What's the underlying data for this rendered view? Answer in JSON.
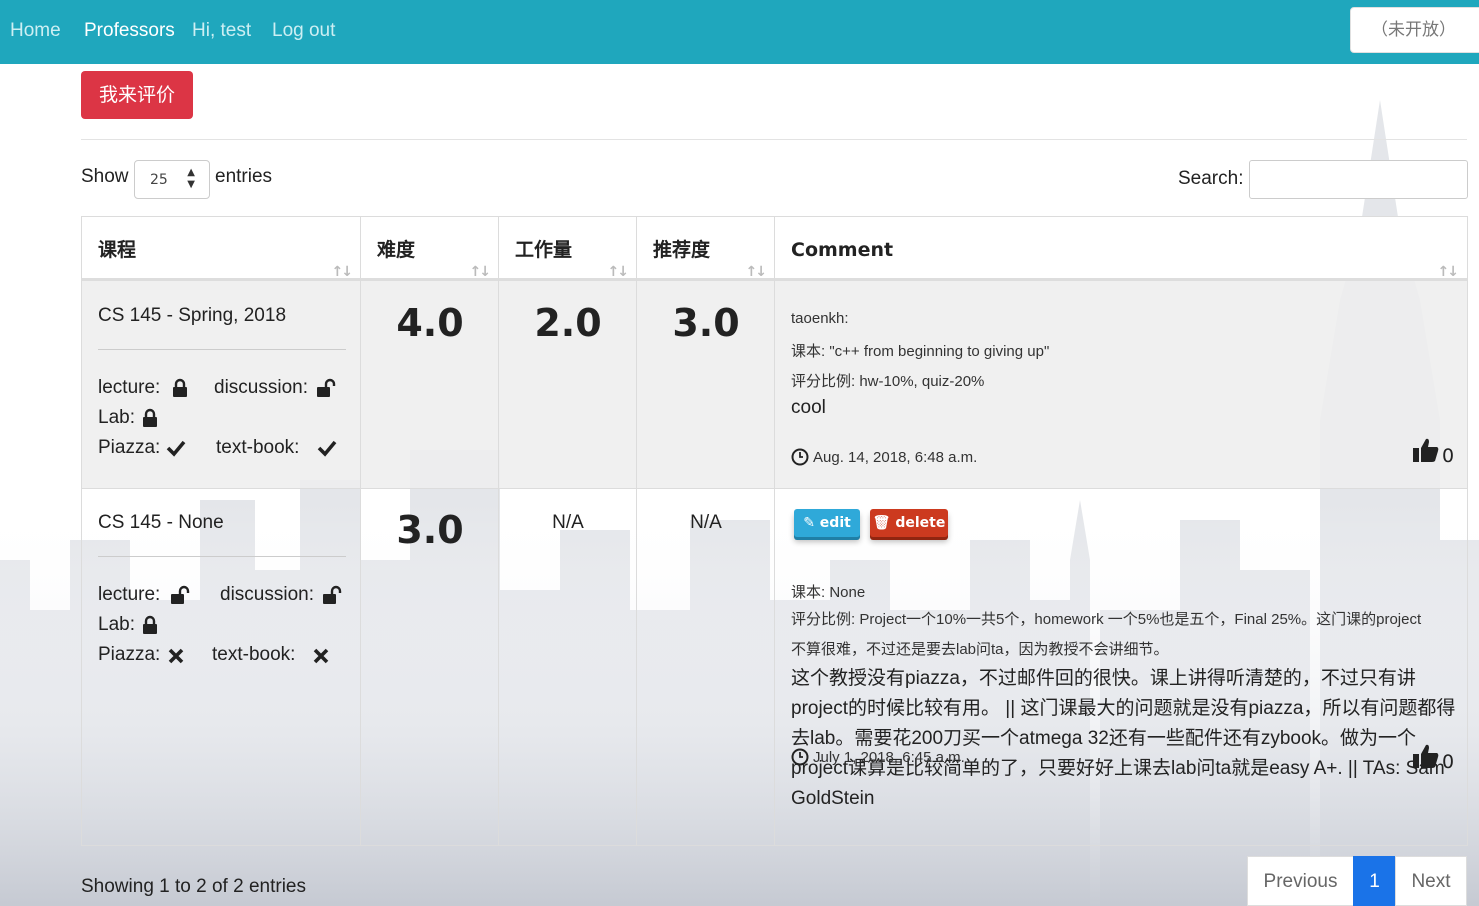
{
  "nav": {
    "links": [
      "Home",
      "Professors",
      "Hi, test",
      "Log out"
    ],
    "right_button": "（未开放）",
    "color": "#1fa7bd"
  },
  "rate_button": "我来评价",
  "controls": {
    "show_label": "Show",
    "entries_value": "25",
    "entries_label": "entries",
    "search_label": "Search:",
    "search_value": ""
  },
  "table": {
    "headers": [
      "课程",
      "难度",
      "工作量",
      "推荐度",
      "Comment"
    ],
    "rows": [
      {
        "course": "CS 145 - Spring, 2018",
        "lecture_label": "lecture:",
        "lecture_icon": "lock-icon",
        "discussion_label": "discussion:",
        "discussion_icon": "unlock-icon",
        "lab_label": "Lab:",
        "lab_icon": "lock-icon",
        "piazza_label": "Piazza:",
        "piazza_icon": "check-icon",
        "textbook_label": "text-book:",
        "textbook_icon": "check-icon",
        "difficulty": "4.0",
        "workload": "2.0",
        "recommend": "3.0",
        "author": "taoenkh:",
        "textbook_line": "课本: \"c++ from beginning to giving up\"",
        "grading_line": "评分比例: hw-10%, quiz-20%",
        "comment": "cool",
        "date": "Aug. 14, 2018, 6:48 a.m.",
        "likes": "0"
      },
      {
        "course": "CS 145 - None",
        "lecture_label": "lecture:",
        "lecture_icon": "unlock-icon",
        "discussion_label": "discussion:",
        "discussion_icon": "unlock-icon",
        "lab_label": "Lab:",
        "lab_icon": "lock-icon",
        "piazza_label": "Piazza:",
        "piazza_icon": "cross-icon",
        "textbook_label": "text-book:",
        "textbook_icon": "cross-icon",
        "difficulty": "3.0",
        "workload": "N/A",
        "recommend": "N/A",
        "edit_label": "edit",
        "delete_label": "delete",
        "textbook_line": "课本: None",
        "grading_line": "评分比例: Project一个10%一共5个，homework 一个5%也是五个，Final 25%。这门课的project不算很难，不过还是要去lab问ta，因为教授不会讲细节。",
        "comment": "这个教授没有piazza，不过邮件回的很快。课上讲得听清楚的，不过只有讲project的时候比较有用。 || 这门课最大的问题就是没有piazza，所以有问题都得去lab。需要花200刀买一个atmega 32还有一些配件还有zybook。做为一个project课算是比较简单的了，只要好好上课去lab问ta就是easy A+. || TAs: Sam GoldStein",
        "date": "July 1, 2018, 6:45 a.m.",
        "likes": "0"
      }
    ]
  },
  "footer": {
    "info": "Showing 1 to 2 of 2 entries",
    "previous": "Previous",
    "page": "1",
    "next": "Next"
  }
}
